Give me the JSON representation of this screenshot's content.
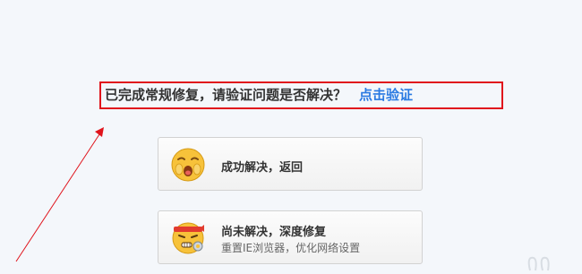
{
  "prompt": {
    "text": "已完成常规修复，请验证问题是否解决？",
    "link_label": "点击验证"
  },
  "options": [
    {
      "title": "成功解决，返回",
      "icon": "happy-face-icon"
    },
    {
      "title": "尚未解决，深度修复",
      "subtitle": "重置IE浏览器，优化网络设置",
      "icon": "wrench-face-icon"
    }
  ],
  "colors": {
    "annotation": "#e0141c",
    "link": "#2a7ae2",
    "emoji_fill": "#f7c23a"
  }
}
